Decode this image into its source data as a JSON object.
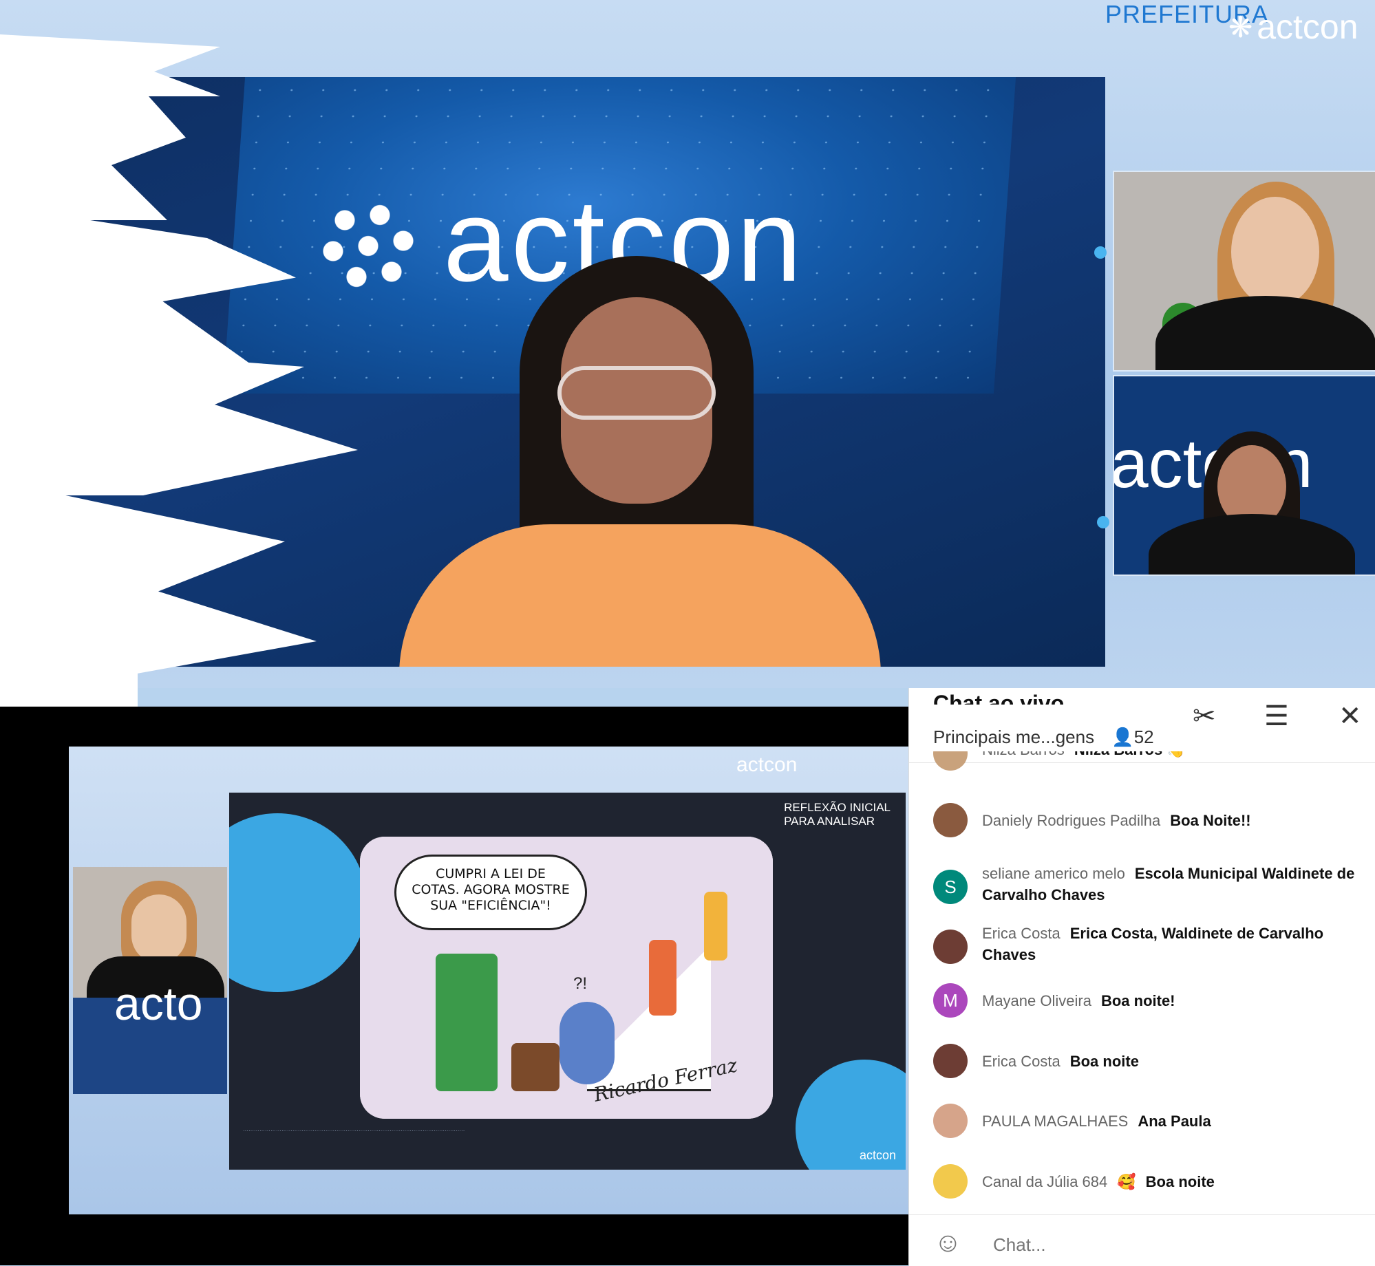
{
  "header": {
    "prefeitura": "PREFEITURA",
    "brand": "actcon"
  },
  "main_video": {
    "brand": "actcon"
  },
  "participants": [
    {
      "brand": ""
    },
    {
      "brand": "actcon"
    }
  ],
  "slide": {
    "brand_top": "actcon",
    "title": "REFLEXÃO INICIAL\nPARA ANALISAR",
    "bubble": "CUMPRI A LEI DE\nCOTAS. AGORA MOSTRE\nSUA \"EFICIÊNCIA\"!",
    "bubble_qmarks": "?!",
    "signature": "Ricardo Ferraz",
    "footer_brand": "actcon",
    "side_brand": "acto"
  },
  "chat": {
    "title": "Chat ao vivo",
    "mode": "Principais me...gens",
    "viewers": "52",
    "input_placeholder": "Chat...",
    "icons": {
      "cut": "scissors-icon",
      "settings": "sliders-icon",
      "close": "close-icon",
      "emoji": "smiley-icon"
    },
    "messages": [
      {
        "author": "Nilza Barros",
        "text": "Nilza Barros",
        "avatar": "",
        "avatar_color": "#c9a27c",
        "emoji": "👋"
      },
      {
        "author": "Daniely Rodrigues Padilha",
        "text": "Boa Noite!!",
        "avatar": "",
        "avatar_color": "#8a5a3f"
      },
      {
        "author": "seliane americo melo",
        "text": "Escola Municipal Waldinete de Carvalho Chaves",
        "avatar": "S",
        "avatar_color": "#00897b"
      },
      {
        "author": "Erica Costa",
        "text": "Erica Costa, Waldinete de Carvalho Chaves",
        "avatar": "",
        "avatar_color": "#6d3d34"
      },
      {
        "author": "Mayane Oliveira",
        "text": "Boa noite!",
        "avatar": "M",
        "avatar_color": "#ab47bc"
      },
      {
        "author": "Erica Costa",
        "text": "Boa noite",
        "avatar": "",
        "avatar_color": "#6d3d34"
      },
      {
        "author": "PAULA MAGALHAES",
        "text": "Ana Paula",
        "avatar": "",
        "avatar_color": "#d6a48a"
      },
      {
        "author": "Canal da Júlia 684",
        "text": "Boa noite",
        "avatar": "",
        "avatar_color": "#f2c94c",
        "emoji": "🥰"
      }
    ]
  }
}
